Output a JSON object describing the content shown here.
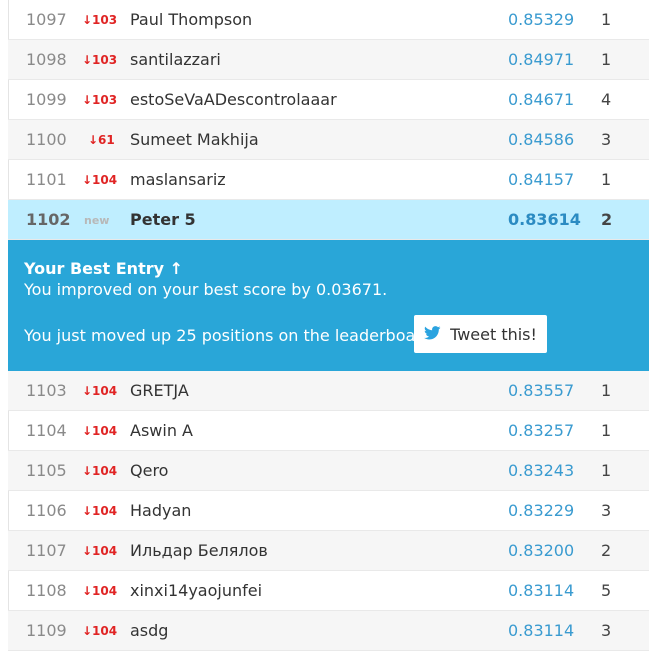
{
  "rows_top": [
    {
      "rank": "1097",
      "delta": "↓103",
      "name": "Paul Thompson",
      "score": "0.85329",
      "entries": "1"
    },
    {
      "rank": "1098",
      "delta": "↓103",
      "name": "santilazzari",
      "score": "0.84971",
      "entries": "1"
    },
    {
      "rank": "1099",
      "delta": "↓103",
      "name": "estoSeVaADescontrolaaar",
      "score": "0.84671",
      "entries": "4"
    },
    {
      "rank": "1100",
      "delta": "↓61",
      "name": "Sumeet Makhija",
      "score": "0.84586",
      "entries": "3"
    },
    {
      "rank": "1101",
      "delta": "↓104",
      "name": "maslansariz",
      "score": "0.84157",
      "entries": "1"
    }
  ],
  "me": {
    "rank": "1102",
    "delta": "new",
    "name": "Peter 5",
    "score": "0.83614",
    "entries": "2"
  },
  "banner": {
    "title": "Your Best Entry ↑",
    "line1": "You improved on your best score by 0.03671.",
    "line2": "You just moved up 25 positions on the leaderboard.",
    "tweet_label": "Tweet this!"
  },
  "rows_bottom": [
    {
      "rank": "1103",
      "delta": "↓104",
      "name": "GRETJA",
      "score": "0.83557",
      "entries": "1"
    },
    {
      "rank": "1104",
      "delta": "↓104",
      "name": "Aswin A",
      "score": "0.83257",
      "entries": "1"
    },
    {
      "rank": "1105",
      "delta": "↓104",
      "name": "Qero",
      "score": "0.83243",
      "entries": "1"
    },
    {
      "rank": "1106",
      "delta": "↓104",
      "name": "Hadyan",
      "score": "0.83229",
      "entries": "3"
    },
    {
      "rank": "1107",
      "delta": "↓104",
      "name": "Ильдар Белялов",
      "score": "0.83200",
      "entries": "2"
    },
    {
      "rank": "1108",
      "delta": "↓104",
      "name": "xinxi14yaojunfei",
      "score": "0.83114",
      "entries": "5"
    },
    {
      "rank": "1109",
      "delta": "↓104",
      "name": "asdg",
      "score": "0.83114",
      "entries": "3"
    }
  ],
  "colors": {
    "banner_bg": "#29a6d8",
    "highlight_row": "#bfeeff",
    "score_text": "#3a9bd0",
    "rank_drop": "#e02424"
  },
  "icons": {
    "tweet": "twitter-bird-icon"
  }
}
